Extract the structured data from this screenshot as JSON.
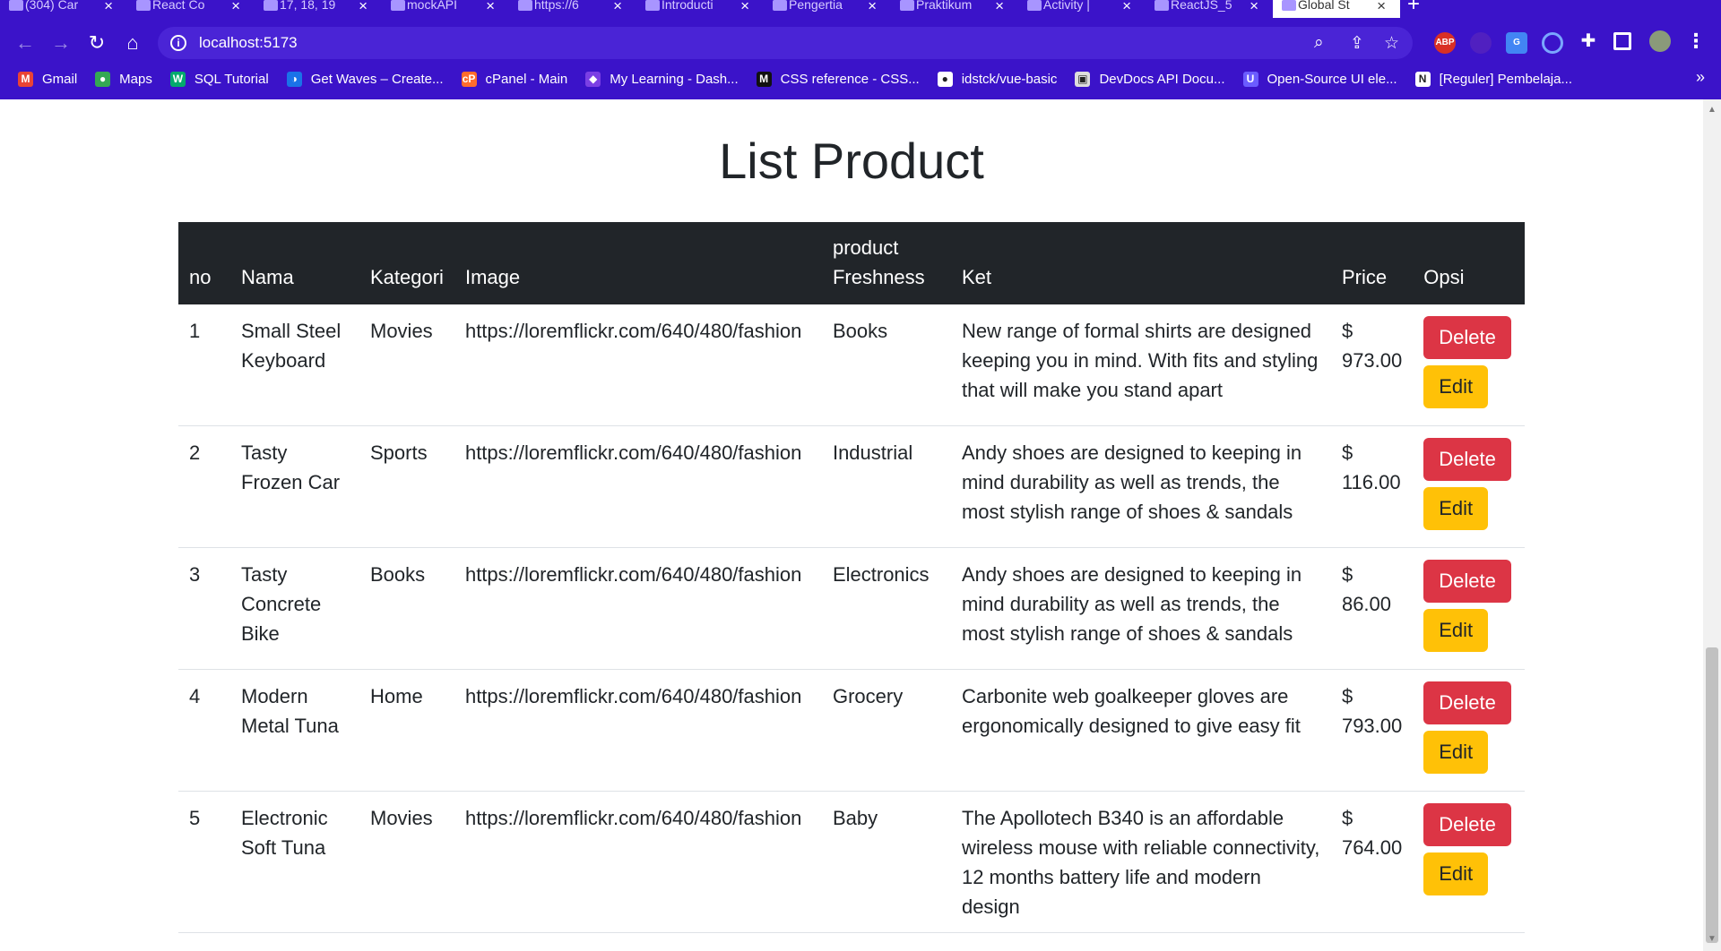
{
  "browser": {
    "tabs": [
      {
        "title": "(304) Car"
      },
      {
        "title": "React Co"
      },
      {
        "title": "17, 18, 19"
      },
      {
        "title": "mockAPI"
      },
      {
        "title": "https://6"
      },
      {
        "title": "Introducti"
      },
      {
        "title": "Pengertia"
      },
      {
        "title": "Praktikum"
      },
      {
        "title": "Activity |"
      },
      {
        "title": "ReactJS_5"
      },
      {
        "title": "Global St"
      }
    ],
    "address": "localhost:5173",
    "bookmarks": [
      {
        "label": "Gmail",
        "color": "#ea4335",
        "glyph": "M"
      },
      {
        "label": "Maps",
        "color": "#34a853",
        "glyph": "●"
      },
      {
        "label": "SQL Tutorial",
        "color": "#04aa6d",
        "glyph": "W"
      },
      {
        "label": "Get Waves – Create...",
        "color": "#1a73e8",
        "glyph": "◑"
      },
      {
        "label": "cPanel - Main",
        "color": "#ff6c2c",
        "glyph": "cP"
      },
      {
        "label": "My Learning - Dash...",
        "color": "#7b3fe4",
        "glyph": "◆"
      },
      {
        "label": "CSS reference - CSS...",
        "color": "#111111",
        "glyph": "M"
      },
      {
        "label": "idstck/vue-basic",
        "color": "#ffffff",
        "glyph": "●"
      },
      {
        "label": "DevDocs API Docu...",
        "color": "#dddddd",
        "glyph": "▣"
      },
      {
        "label": "Open-Source UI ele...",
        "color": "#6b5cff",
        "glyph": "U"
      },
      {
        "label": "[Reguler] Pembelaja...",
        "color": "#ffffff",
        "glyph": "N"
      }
    ]
  },
  "page": {
    "title": "List Product",
    "columns": [
      "no",
      "Nama",
      "Kategori",
      "Image",
      "product Freshness",
      "Ket",
      "Price",
      "Opsi"
    ],
    "delete_label": "Delete",
    "edit_label": "Edit",
    "rows": [
      {
        "no": "1",
        "nama": "Small Steel Keyboard",
        "kategori": "Movies",
        "image": "https://loremflickr.com/640/480/fashion",
        "freshness": "Books",
        "ket": "New range of formal shirts are designed keeping you in mind. With fits and styling that will make you stand apart",
        "price": "$ 973.00"
      },
      {
        "no": "2",
        "nama": "Tasty Frozen Car",
        "kategori": "Sports",
        "image": "https://loremflickr.com/640/480/fashion",
        "freshness": "Industrial",
        "ket": "Andy shoes are designed to keeping in mind durability as well as trends, the most stylish range of shoes & sandals",
        "price": "$ 116.00"
      },
      {
        "no": "3",
        "nama": "Tasty Concrete Bike",
        "kategori": "Books",
        "image": "https://loremflickr.com/640/480/fashion",
        "freshness": "Electronics",
        "ket": "Andy shoes are designed to keeping in mind durability as well as trends, the most stylish range of shoes & sandals",
        "price": "$ 86.00"
      },
      {
        "no": "4",
        "nama": "Modern Metal Tuna",
        "kategori": "Home",
        "image": "https://loremflickr.com/640/480/fashion",
        "freshness": "Grocery",
        "ket": "Carbonite web goalkeeper gloves are ergonomically designed to give easy fit",
        "price": "$ 793.00"
      },
      {
        "no": "5",
        "nama": "Electronic Soft Tuna",
        "kategori": "Movies",
        "image": "https://loremflickr.com/640/480/fashion",
        "freshness": "Baby",
        "ket": "The Apollotech B340 is an affordable wireless mouse with reliable connectivity, 12 months battery life and modern design",
        "price": "$ 764.00"
      }
    ]
  }
}
